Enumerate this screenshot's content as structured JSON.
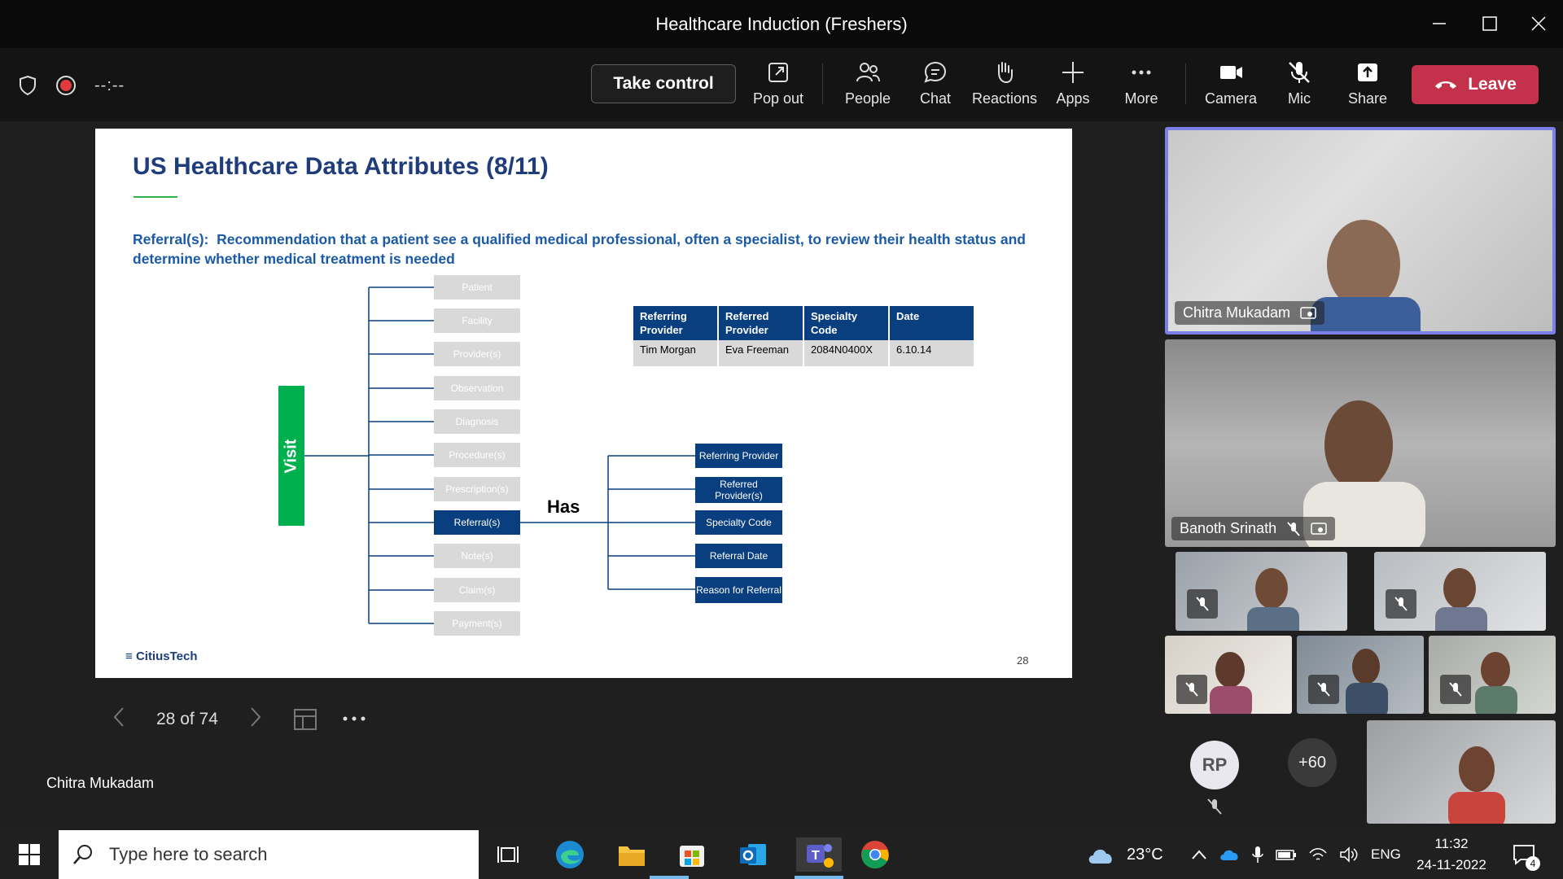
{
  "window": {
    "title": "Healthcare Induction (Freshers)"
  },
  "toolbar": {
    "timer": "--:--",
    "take_control": "Take control",
    "pop_out": "Pop out",
    "people": "People",
    "chat": "Chat",
    "reactions": "Reactions",
    "apps": "Apps",
    "more": "More",
    "camera": "Camera",
    "mic": "Mic",
    "share": "Share",
    "leave": "Leave"
  },
  "slide": {
    "title": "US Healthcare Data Attributes (8/11)",
    "definition_term": "Referral(s):",
    "definition": "Recommendation that a patient see a qualified medical professional, often a specialist, to review their health status and determine whether medical treatment is needed",
    "visit": "Visit",
    "has": "Has",
    "attributes": [
      "Patient",
      "Facility",
      "Provider(s)",
      "Observation",
      "Diagnosis",
      "Procedure(s)",
      "Prescription(s)",
      "Referral(s)",
      "Note(s)",
      "Claim(s)",
      "Payment(s)"
    ],
    "referral_fields": [
      "Referring Provider",
      "Referred Provider(s)",
      "Specialty Code",
      "Referral Date",
      "Reason for Referral"
    ],
    "table": {
      "headers": [
        "Referring Provider",
        "Referred Provider",
        "Specialty Code",
        "Date"
      ],
      "row": [
        "Tim Morgan",
        "Eva Freeman",
        "2084N0400X",
        "6.10.14"
      ]
    },
    "brand": "CitiusTech",
    "page_number": "28"
  },
  "slide_nav": {
    "position": "28 of 74"
  },
  "presenter": "Chitra Mukadam",
  "participants": {
    "main": "Chitra Mukadam",
    "second": "Banoth Srinath",
    "avatar_initials": "RP",
    "overflow": "+60"
  },
  "taskbar": {
    "search_placeholder": "Type here to search",
    "weather": "23°C",
    "language": "ENG",
    "time": "11:32",
    "date": "24-11-2022",
    "notifications": "4"
  },
  "colors": {
    "accent": "#6264a7",
    "leave": "#c4314b",
    "slide_blue": "#0a3f7f",
    "visit_green": "#00b04f"
  }
}
